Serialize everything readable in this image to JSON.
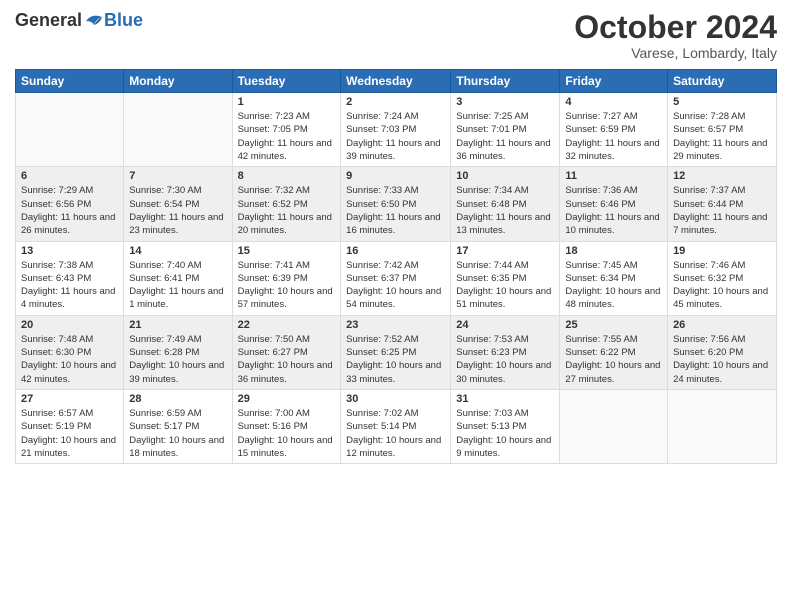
{
  "header": {
    "logo_general": "General",
    "logo_blue": "Blue",
    "month_title": "October 2024",
    "location": "Varese, Lombardy, Italy"
  },
  "calendar": {
    "days_of_week": [
      "Sunday",
      "Monday",
      "Tuesday",
      "Wednesday",
      "Thursday",
      "Friday",
      "Saturday"
    ],
    "weeks": [
      [
        {
          "day": "",
          "info": ""
        },
        {
          "day": "",
          "info": ""
        },
        {
          "day": "1",
          "info": "Sunrise: 7:23 AM\nSunset: 7:05 PM\nDaylight: 11 hours and 42 minutes."
        },
        {
          "day": "2",
          "info": "Sunrise: 7:24 AM\nSunset: 7:03 PM\nDaylight: 11 hours and 39 minutes."
        },
        {
          "day": "3",
          "info": "Sunrise: 7:25 AM\nSunset: 7:01 PM\nDaylight: 11 hours and 36 minutes."
        },
        {
          "day": "4",
          "info": "Sunrise: 7:27 AM\nSunset: 6:59 PM\nDaylight: 11 hours and 32 minutes."
        },
        {
          "day": "5",
          "info": "Sunrise: 7:28 AM\nSunset: 6:57 PM\nDaylight: 11 hours and 29 minutes."
        }
      ],
      [
        {
          "day": "6",
          "info": "Sunrise: 7:29 AM\nSunset: 6:56 PM\nDaylight: 11 hours and 26 minutes."
        },
        {
          "day": "7",
          "info": "Sunrise: 7:30 AM\nSunset: 6:54 PM\nDaylight: 11 hours and 23 minutes."
        },
        {
          "day": "8",
          "info": "Sunrise: 7:32 AM\nSunset: 6:52 PM\nDaylight: 11 hours and 20 minutes."
        },
        {
          "day": "9",
          "info": "Sunrise: 7:33 AM\nSunset: 6:50 PM\nDaylight: 11 hours and 16 minutes."
        },
        {
          "day": "10",
          "info": "Sunrise: 7:34 AM\nSunset: 6:48 PM\nDaylight: 11 hours and 13 minutes."
        },
        {
          "day": "11",
          "info": "Sunrise: 7:36 AM\nSunset: 6:46 PM\nDaylight: 11 hours and 10 minutes."
        },
        {
          "day": "12",
          "info": "Sunrise: 7:37 AM\nSunset: 6:44 PM\nDaylight: 11 hours and 7 minutes."
        }
      ],
      [
        {
          "day": "13",
          "info": "Sunrise: 7:38 AM\nSunset: 6:43 PM\nDaylight: 11 hours and 4 minutes."
        },
        {
          "day": "14",
          "info": "Sunrise: 7:40 AM\nSunset: 6:41 PM\nDaylight: 11 hours and 1 minute."
        },
        {
          "day": "15",
          "info": "Sunrise: 7:41 AM\nSunset: 6:39 PM\nDaylight: 10 hours and 57 minutes."
        },
        {
          "day": "16",
          "info": "Sunrise: 7:42 AM\nSunset: 6:37 PM\nDaylight: 10 hours and 54 minutes."
        },
        {
          "day": "17",
          "info": "Sunrise: 7:44 AM\nSunset: 6:35 PM\nDaylight: 10 hours and 51 minutes."
        },
        {
          "day": "18",
          "info": "Sunrise: 7:45 AM\nSunset: 6:34 PM\nDaylight: 10 hours and 48 minutes."
        },
        {
          "day": "19",
          "info": "Sunrise: 7:46 AM\nSunset: 6:32 PM\nDaylight: 10 hours and 45 minutes."
        }
      ],
      [
        {
          "day": "20",
          "info": "Sunrise: 7:48 AM\nSunset: 6:30 PM\nDaylight: 10 hours and 42 minutes."
        },
        {
          "day": "21",
          "info": "Sunrise: 7:49 AM\nSunset: 6:28 PM\nDaylight: 10 hours and 39 minutes."
        },
        {
          "day": "22",
          "info": "Sunrise: 7:50 AM\nSunset: 6:27 PM\nDaylight: 10 hours and 36 minutes."
        },
        {
          "day": "23",
          "info": "Sunrise: 7:52 AM\nSunset: 6:25 PM\nDaylight: 10 hours and 33 minutes."
        },
        {
          "day": "24",
          "info": "Sunrise: 7:53 AM\nSunset: 6:23 PM\nDaylight: 10 hours and 30 minutes."
        },
        {
          "day": "25",
          "info": "Sunrise: 7:55 AM\nSunset: 6:22 PM\nDaylight: 10 hours and 27 minutes."
        },
        {
          "day": "26",
          "info": "Sunrise: 7:56 AM\nSunset: 6:20 PM\nDaylight: 10 hours and 24 minutes."
        }
      ],
      [
        {
          "day": "27",
          "info": "Sunrise: 6:57 AM\nSunset: 5:19 PM\nDaylight: 10 hours and 21 minutes."
        },
        {
          "day": "28",
          "info": "Sunrise: 6:59 AM\nSunset: 5:17 PM\nDaylight: 10 hours and 18 minutes."
        },
        {
          "day": "29",
          "info": "Sunrise: 7:00 AM\nSunset: 5:16 PM\nDaylight: 10 hours and 15 minutes."
        },
        {
          "day": "30",
          "info": "Sunrise: 7:02 AM\nSunset: 5:14 PM\nDaylight: 10 hours and 12 minutes."
        },
        {
          "day": "31",
          "info": "Sunrise: 7:03 AM\nSunset: 5:13 PM\nDaylight: 10 hours and 9 minutes."
        },
        {
          "day": "",
          "info": ""
        },
        {
          "day": "",
          "info": ""
        }
      ]
    ]
  }
}
